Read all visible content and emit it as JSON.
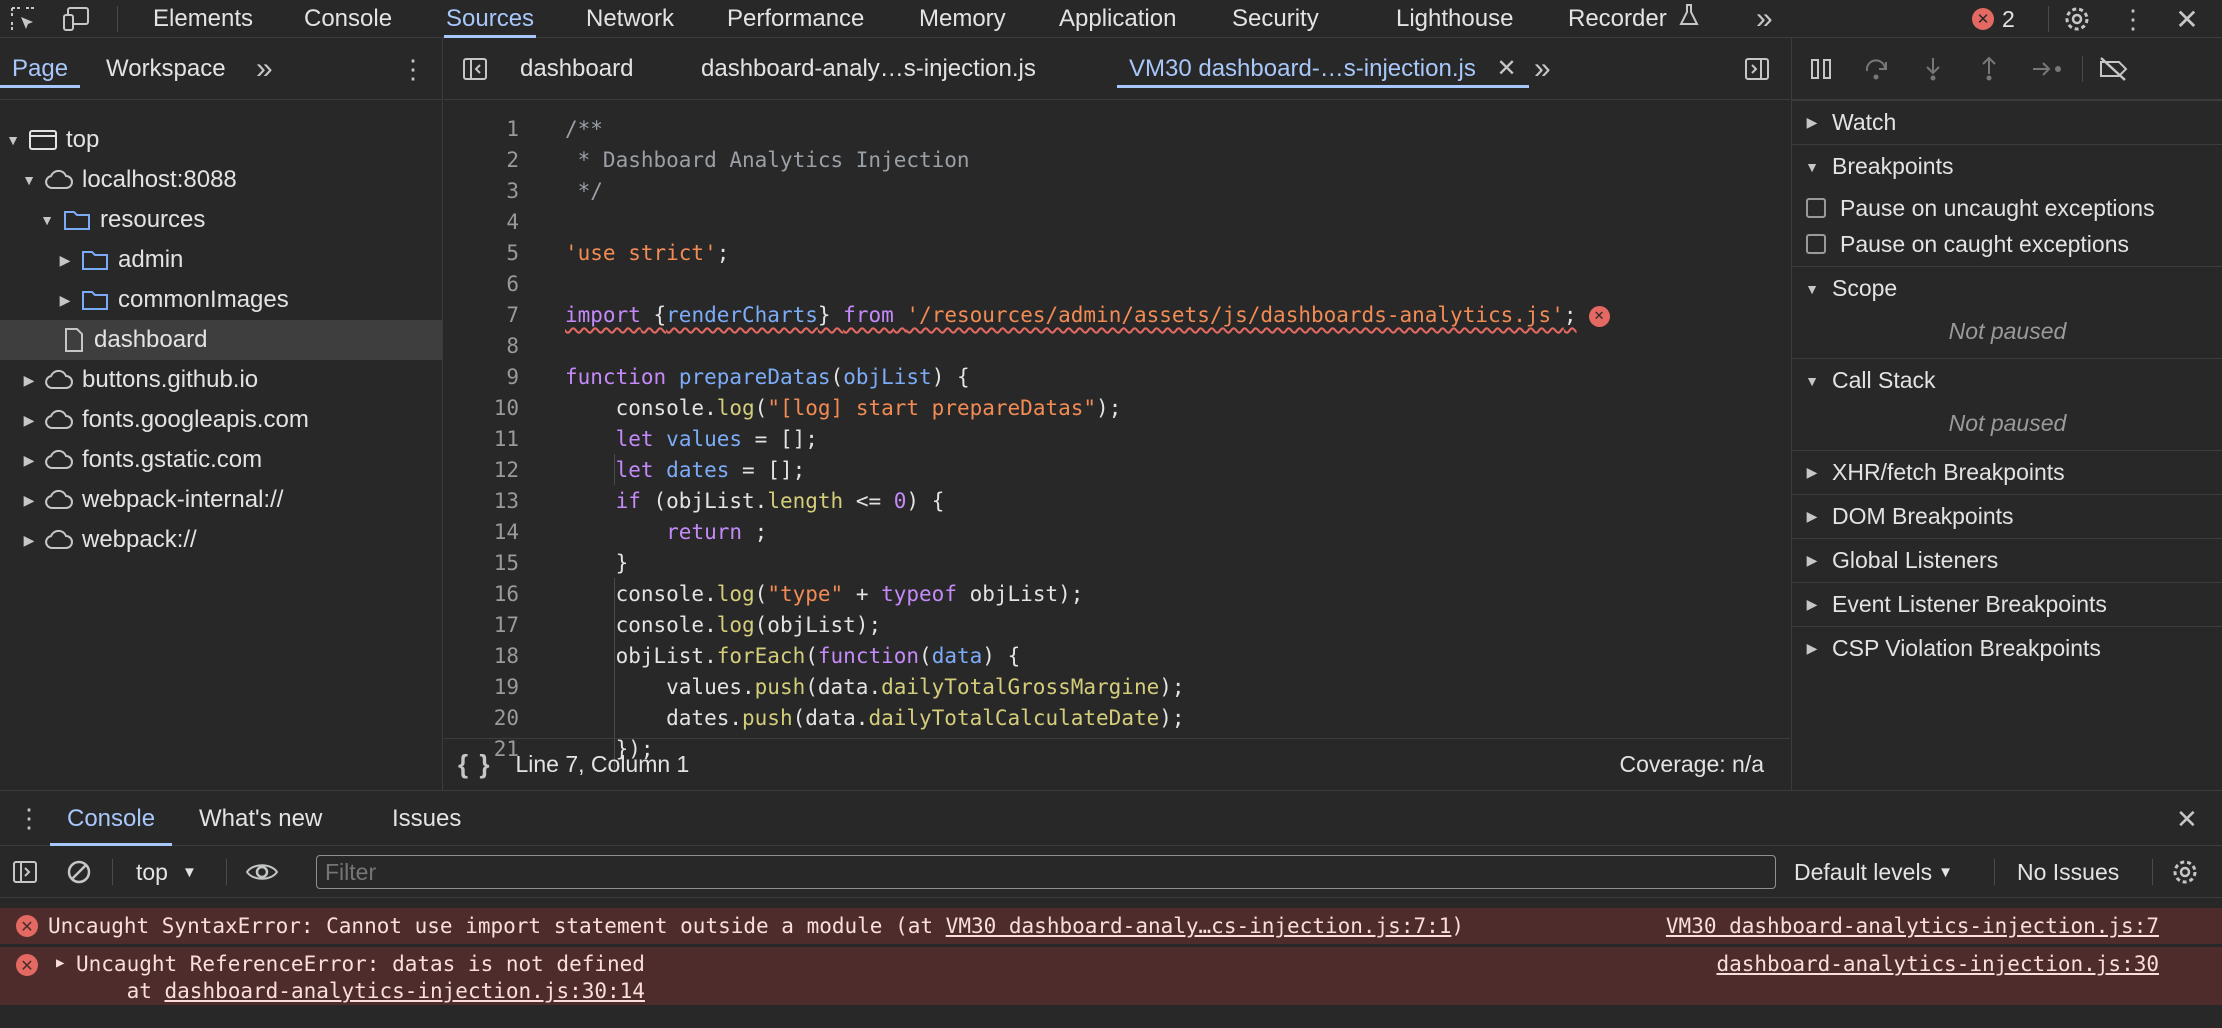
{
  "colors": {
    "accent": "#a8c7fa",
    "error": "#e46962",
    "error_bg": "#4e2c2c",
    "bg": "#282828"
  },
  "topbar": {
    "tabs": [
      "Elements",
      "Console",
      "Sources",
      "Network",
      "Performance",
      "Memory",
      "Application",
      "Security",
      "Lighthouse",
      "Recorder"
    ],
    "active_tab": "Sources",
    "more": "»",
    "error_count": "2",
    "icons": [
      "inspect-icon",
      "device-toggle-icon",
      "flask-icon",
      "settings-icon",
      "kebab-menu-icon",
      "close-icon"
    ]
  },
  "navigator": {
    "tabs": [
      "Page",
      "Workspace"
    ],
    "more": "»",
    "tree": [
      {
        "label": "top",
        "icon": "frame-icon",
        "expanded": true,
        "indent": 0
      },
      {
        "label": "localhost:8088",
        "icon": "cloud-icon",
        "expanded": true,
        "indent": 1
      },
      {
        "label": "resources",
        "icon": "folder-icon",
        "expanded": true,
        "indent": 2
      },
      {
        "label": "admin",
        "icon": "folder-icon",
        "expanded": false,
        "indent": 3
      },
      {
        "label": "commonImages",
        "icon": "folder-icon",
        "expanded": false,
        "indent": 3
      },
      {
        "label": "dashboard",
        "icon": "file-icon",
        "expanded": null,
        "indent": 2,
        "selected": true
      },
      {
        "label": "buttons.github.io",
        "icon": "cloud-icon",
        "expanded": false,
        "indent": 1
      },
      {
        "label": "fonts.googleapis.com",
        "icon": "cloud-icon",
        "expanded": false,
        "indent": 1
      },
      {
        "label": "fonts.gstatic.com",
        "icon": "cloud-icon",
        "expanded": false,
        "indent": 1
      },
      {
        "label": "webpack-internal://",
        "icon": "cloud-icon",
        "expanded": false,
        "indent": 1
      },
      {
        "label": "webpack://",
        "icon": "cloud-icon",
        "expanded": false,
        "indent": 1
      }
    ]
  },
  "editor": {
    "tabs": [
      "dashboard",
      "dashboard-analy…s-injection.js",
      "VM30 dashboard-…s-injection.js"
    ],
    "active_tab": "VM30 dashboard-…s-injection.js",
    "more": "»",
    "lines": [
      [
        [
          "c",
          "/**"
        ]
      ],
      [
        [
          "c",
          " * Dashboard Analytics Injection"
        ]
      ],
      [
        [
          "c",
          " */"
        ]
      ],
      [],
      [
        [
          "s",
          "'use strict'"
        ],
        [
          "v",
          ";"
        ]
      ],
      [],
      [
        [
          "k",
          "import"
        ],
        [
          "v",
          " {"
        ],
        [
          "p",
          "renderCharts"
        ],
        [
          "v",
          "} "
        ],
        [
          "k",
          "from"
        ],
        [
          "v",
          " "
        ],
        [
          "s",
          "'/resources/admin/assets/js/dashboards-analytics.js'"
        ],
        [
          "v",
          ";"
        ]
      ],
      [],
      [
        [
          "k",
          "function"
        ],
        [
          "v",
          " "
        ],
        [
          "p",
          "prepareDatas"
        ],
        [
          "v",
          "("
        ],
        [
          "p",
          "objList"
        ],
        [
          "v",
          ") {"
        ]
      ],
      [
        [
          "v",
          "    console."
        ],
        [
          "f",
          "log"
        ],
        [
          "v",
          "("
        ],
        [
          "s",
          "\"[log] start prepareDatas\""
        ],
        [
          "v",
          ");"
        ]
      ],
      [
        [
          "v",
          "    "
        ],
        [
          "k",
          "let"
        ],
        [
          "v",
          " "
        ],
        [
          "p",
          "values"
        ],
        [
          "v",
          " = [];"
        ]
      ],
      [
        [
          "v",
          "    "
        ],
        [
          "k",
          "let"
        ],
        [
          "v",
          " "
        ],
        [
          "p",
          "dates"
        ],
        [
          "v",
          " = [];"
        ]
      ],
      [
        [
          "v",
          "    "
        ],
        [
          "k",
          "if"
        ],
        [
          "v",
          " (objList."
        ],
        [
          "f",
          "length"
        ],
        [
          "v",
          " <= "
        ],
        [
          "k",
          "0"
        ],
        [
          "v",
          ") {"
        ]
      ],
      [
        [
          "v",
          "        "
        ],
        [
          "k",
          "return"
        ],
        [
          "v",
          " ;"
        ]
      ],
      [
        [
          "v",
          "    }"
        ]
      ],
      [
        [
          "v",
          "    console."
        ],
        [
          "f",
          "log"
        ],
        [
          "v",
          "("
        ],
        [
          "s",
          "\"type\""
        ],
        [
          "v",
          " + "
        ],
        [
          "k",
          "typeof"
        ],
        [
          "v",
          " objList);"
        ]
      ],
      [
        [
          "v",
          "    console."
        ],
        [
          "f",
          "log"
        ],
        [
          "v",
          "(objList);"
        ]
      ],
      [
        [
          "v",
          "    objList."
        ],
        [
          "f",
          "forEach"
        ],
        [
          "v",
          "("
        ],
        [
          "k",
          "function"
        ],
        [
          "v",
          "("
        ],
        [
          "p",
          "data"
        ],
        [
          "v",
          ") {"
        ]
      ],
      [
        [
          "v",
          "        values."
        ],
        [
          "f",
          "push"
        ],
        [
          "v",
          "(data."
        ],
        [
          "f",
          "dailyTotalGrossMargine"
        ],
        [
          "v",
          ");"
        ]
      ],
      [
        [
          "v",
          "        dates."
        ],
        [
          "f",
          "push"
        ],
        [
          "v",
          "(data."
        ],
        [
          "f",
          "dailyTotalCalculateDate"
        ],
        [
          "v",
          ");"
        ]
      ],
      [
        [
          "v",
          "    });"
        ]
      ]
    ],
    "status": {
      "position": "Line 7, Column 1",
      "coverage": "Coverage: n/a",
      "format_icon": "{ }"
    }
  },
  "debugger": {
    "sections": [
      {
        "label": "Watch",
        "expanded": false
      },
      {
        "label": "Breakpoints",
        "expanded": true
      },
      {
        "label": "Scope",
        "expanded": true
      },
      {
        "label": "Call Stack",
        "expanded": true
      },
      {
        "label": "XHR/fetch Breakpoints",
        "expanded": false
      },
      {
        "label": "DOM Breakpoints",
        "expanded": false
      },
      {
        "label": "Global Listeners",
        "expanded": false
      },
      {
        "label": "Event Listener Breakpoints",
        "expanded": false
      },
      {
        "label": "CSP Violation Breakpoints",
        "expanded": false
      }
    ],
    "breakpoint_options": [
      "Pause on uncaught exceptions",
      "Pause on caught exceptions"
    ],
    "not_paused": "Not paused"
  },
  "drawer": {
    "tabs": [
      "Console",
      "What's new",
      "Issues"
    ],
    "active_tab": "Console",
    "context": "top",
    "filter_placeholder": "Filter",
    "levels": "Default levels",
    "issues": "No Issues",
    "messages": [
      {
        "text": "Uncaught SyntaxError: Cannot use import statement outside a module (at ",
        "inline_link": "VM30 dashboard-analy…cs-injection.js:7:1",
        "after": ")",
        "source": "VM30 dashboard-analytics-injection.js:7"
      },
      {
        "text": "Uncaught ReferenceError: datas is not defined",
        "at_prefix": "    at ",
        "inline_link": "dashboard-analytics-injection.js:30:14",
        "source": "dashboard-analytics-injection.js:30"
      }
    ]
  }
}
